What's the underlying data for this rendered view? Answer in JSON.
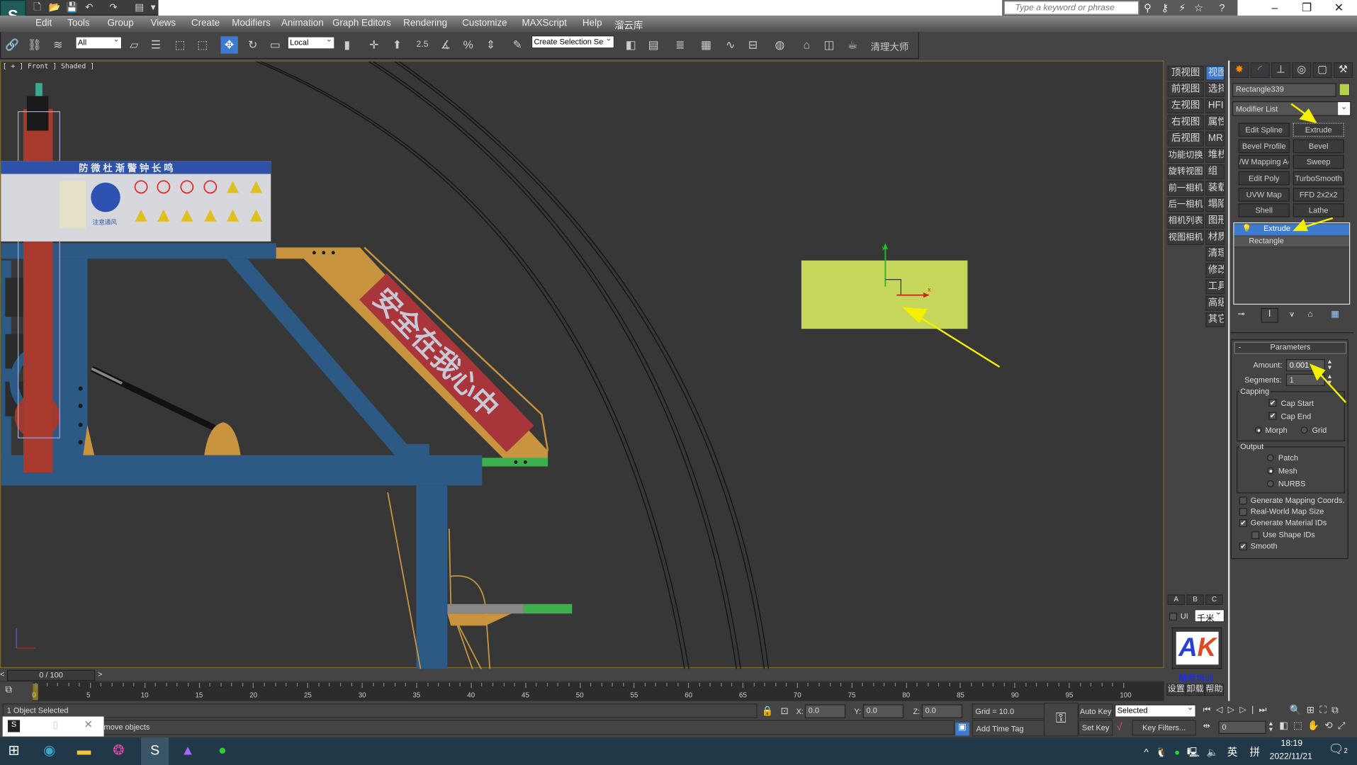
{
  "app": {
    "logo": "S"
  },
  "search": {
    "placeholder": "Type a keyword or phrase"
  },
  "menu": [
    "Edit",
    "Tools",
    "Group",
    "Views",
    "Create",
    "Modifiers",
    "Animation",
    "Graph Editors",
    "Rendering",
    "Customize",
    "MAXScript",
    "Help",
    "溜云库"
  ],
  "toolbar": {
    "selection_filter": "All",
    "coord_system": "Local",
    "selection_set": "Create Selection Se",
    "snap_label": "2.5",
    "plugin_label": "清理大师"
  },
  "viewport": {
    "label": "[ + ] Front ] Shaded ]",
    "sign_header": "防 微 杜 渐   警 钟 长 鸣",
    "sign_slogan": "安全在我心中",
    "sign_item1": "注意通风",
    "object_color": "#c5d65a"
  },
  "strip": {
    "col1": [
      "顶视图",
      "前视图",
      "左视图",
      "右视图",
      "后视图",
      "功能切换",
      "旋转视图",
      "前一相机",
      "后一相机",
      "相机列表",
      "视图相机"
    ],
    "col2": [
      "视图",
      "选择",
      "HFI",
      "属性",
      "MRS",
      "堆栈",
      "组",
      "装载",
      "塌陷",
      "图形",
      "材质",
      "清理",
      "修改",
      "工具",
      "高级",
      "其它"
    ],
    "abc": [
      "A",
      "B",
      "C"
    ],
    "ui_label": "UI",
    "unit": "千米",
    "logo_text": "AK",
    "brand": "酷意培训",
    "bottom": [
      "设置",
      "卸载",
      "帮助"
    ]
  },
  "command": {
    "object_name": "Rectangle339",
    "object_color": "#b5d04a",
    "modifier_list": "Modifier List",
    "modifier_buttons": [
      "Edit Spline",
      "Extrude",
      "Bevel Profile",
      "Bevel",
      "/W Mapping Ac",
      "Sweep",
      "Edit Poly",
      "TurboSmooth",
      "UVW Map",
      "FFD 2x2x2",
      "Shell",
      "Lathe"
    ],
    "stack": [
      "Extrude",
      "Rectangle"
    ],
    "parameters": {
      "title": "Parameters",
      "collapse": "-",
      "amount_label": "Amount:",
      "amount": "0.001",
      "segments_label": "Segments:",
      "segments": "1",
      "capping_label": "Capping",
      "cap_start": "Cap Start",
      "cap_start_checked": true,
      "cap_end": "Cap End",
      "cap_end_checked": true,
      "morph": "Morph",
      "grid": "Grid",
      "cap_type": "Morph",
      "output_label": "Output",
      "patch": "Patch",
      "mesh": "Mesh",
      "nurbs": "NURBS",
      "output": "Mesh",
      "gen_mapping": "Generate Mapping Coords.",
      "gen_mapping_checked": false,
      "real_world": "Real-World Map Size",
      "real_world_checked": false,
      "gen_matids": "Generate Material IDs",
      "gen_matids_checked": true,
      "use_shape_ids": "Use Shape IDs",
      "use_shape_ids_checked": false,
      "smooth": "Smooth",
      "smooth_checked": true
    }
  },
  "timeline": {
    "slider": "0 / 100",
    "prev": "<",
    "next": ">",
    "ticks": [
      "0",
      "5",
      "10",
      "15",
      "20",
      "25",
      "30",
      "35",
      "40",
      "45",
      "50",
      "55",
      "60",
      "65",
      "70",
      "75",
      "80",
      "85",
      "90",
      "95",
      "100"
    ]
  },
  "status": {
    "selection": "1 Object Selected",
    "prompt": "move objects",
    "x_label": "X:",
    "x": "0.0",
    "y_label": "Y:",
    "y": "0.0",
    "z_label": "Z:",
    "z": "0.0",
    "grid": "Grid = 10.0",
    "add_time_tag": "Add Time Tag",
    "auto_key": "Auto Key",
    "set_key": "Set Key",
    "key_mode": "Selected",
    "key_filters": "Key Filters...",
    "frame": "0"
  },
  "taskbar": {
    "time": "18:19",
    "date": "2022/11/21",
    "ime_lang": "英",
    "ime_mode": "拼",
    "notifications": "2"
  }
}
